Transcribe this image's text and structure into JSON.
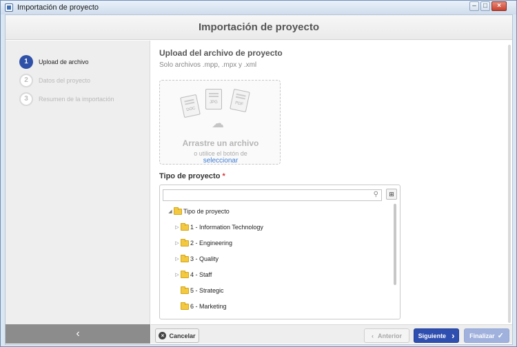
{
  "window": {
    "title": "Importación de proyecto"
  },
  "header": {
    "title": "Importación de proyecto"
  },
  "steps": [
    {
      "num": "1",
      "label": "Upload de archivo",
      "state": "active"
    },
    {
      "num": "2",
      "label": "Datos del proyecto",
      "state": "inactive"
    },
    {
      "num": "3",
      "label": "Resumen de la importación",
      "state": "inactive"
    }
  ],
  "upload": {
    "title": "Upload del archivo de proyecto",
    "subtitle": "Solo archivos .mpp, .mpx y .xml",
    "file_types": [
      "DOC",
      "JPG",
      "PDF"
    ],
    "drop_title": "Arrastre un archivo",
    "drop_sub": "o utilice el botón de",
    "drop_link": "seleccionar"
  },
  "tipo": {
    "label": "Tipo de proyecto",
    "required_mark": "*",
    "search_value": "",
    "tree": [
      {
        "label": "Tipo de proyecto",
        "level": 0,
        "toggle": "expanded"
      },
      {
        "label": "1 - Information Technology",
        "level": 1,
        "toggle": "collapsed"
      },
      {
        "label": "2 - Engineering",
        "level": 1,
        "toggle": "collapsed"
      },
      {
        "label": "3 - Quality",
        "level": 1,
        "toggle": "collapsed"
      },
      {
        "label": "4 - Staff",
        "level": 1,
        "toggle": "collapsed"
      },
      {
        "label": "5 - Strategic",
        "level": 1,
        "toggle": "none"
      },
      {
        "label": "6 - Marketing",
        "level": 1,
        "toggle": "none"
      }
    ]
  },
  "footer": {
    "cancel": "Cancelar",
    "prev": "Anterior",
    "next": "Siguiente",
    "finish": "Finalizar"
  },
  "colors": {
    "accent": "#2f4fb0",
    "disabled_accent": "#9fb1dc",
    "folder": "#f3c941"
  }
}
